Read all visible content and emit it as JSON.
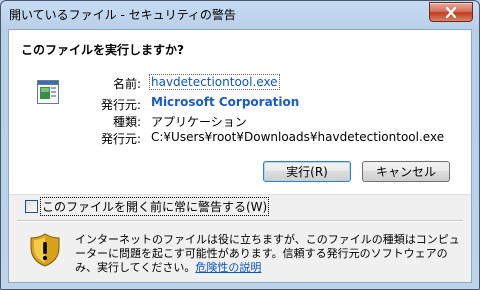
{
  "window": {
    "title": "開いているファイル - セキュリティの警告"
  },
  "dialog": {
    "heading": "このファイルを実行しますか?",
    "fields": {
      "name_label": "名前:",
      "name_value": "havdetectiontool.exe",
      "publisher_label": "発行元:",
      "publisher_value": "Microsoft Corporation",
      "type_label": "種類:",
      "type_value": "アプリケーション",
      "from_label": "発行元:",
      "from_value": "C:¥Users¥root¥Downloads¥havdetectiontool.exe"
    },
    "buttons": {
      "run_label": "実行(R)",
      "cancel_label": "キャンセル"
    },
    "checkbox": {
      "label": "このファイルを開く前に常に警告する(W)",
      "checked": false
    },
    "warning": {
      "text": "インターネットのファイルは役に立ちますが、このファイルの種類はコンピューターに問題を起こす可能性があります。信頼する発行元のソフトウェアのみ、実行してください。",
      "link_label": "危険性の説明"
    }
  },
  "colors": {
    "link": "#0b55c4",
    "close_button": "#c23c21",
    "frame": "#bcd3ea"
  },
  "icons": {
    "close": "close-icon",
    "file": "application-file-icon",
    "shield": "shield-warning-icon"
  }
}
